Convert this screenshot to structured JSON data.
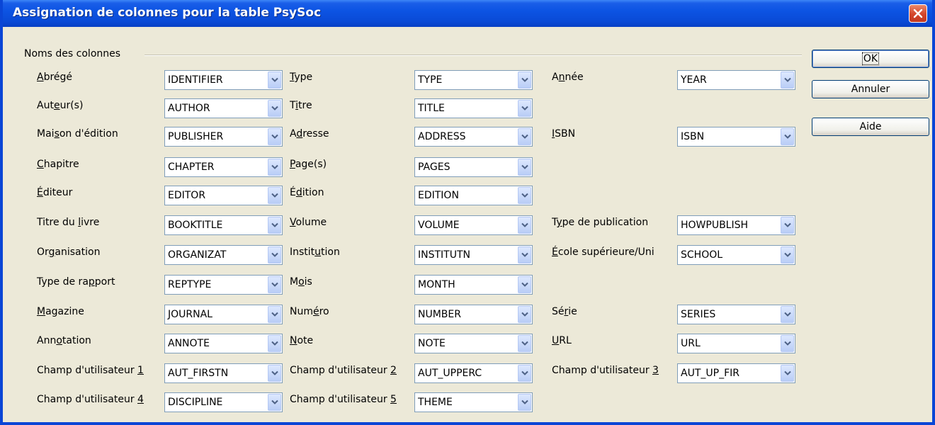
{
  "title": "Assignation de colonnes pour la table PsySoc",
  "group_label": "Noms des colonnes",
  "buttons": {
    "ok": "OK",
    "cancel": "Annuler",
    "help": "Aide"
  },
  "fields": [
    {
      "name": "abrege",
      "pre": "",
      "u": "A",
      "post": "brégé",
      "value": "IDENTIFIER"
    },
    {
      "name": "type",
      "pre": "",
      "u": "T",
      "post": "ype",
      "value": "TYPE"
    },
    {
      "name": "annee",
      "pre": "A",
      "u": "n",
      "post": "née",
      "value": "YEAR"
    },
    {
      "name": "auteurs",
      "pre": "Aut",
      "u": "e",
      "post": "ur(s)",
      "value": "AUTHOR"
    },
    {
      "name": "titre",
      "pre": "T",
      "u": "i",
      "post": "tre",
      "value": "TITLE"
    },
    {
      "name": "maison-edition",
      "pre": "Mai",
      "u": "s",
      "post": "on d'édition",
      "value": "PUBLISHER"
    },
    {
      "name": "adresse",
      "pre": "A",
      "u": "d",
      "post": "resse",
      "value": "ADDRESS"
    },
    {
      "name": "isbn",
      "pre": "",
      "u": "I",
      "post": "SBN",
      "value": "ISBN"
    },
    {
      "name": "chapitre",
      "pre": "",
      "u": "C",
      "post": "hapitre",
      "value": "CHAPTER"
    },
    {
      "name": "pages",
      "pre": "",
      "u": "P",
      "post": "age(s)",
      "value": "PAGES"
    },
    {
      "name": "editeur",
      "pre": "",
      "u": "É",
      "post": "diteur",
      "value": "EDITOR"
    },
    {
      "name": "edition",
      "pre": "É",
      "u": "d",
      "post": "ition",
      "value": "EDITION"
    },
    {
      "name": "titre-livre",
      "pre": "Titre du ",
      "u": "l",
      "post": "ivre",
      "value": "BOOKTITLE"
    },
    {
      "name": "volume",
      "pre": "",
      "u": "V",
      "post": "olume",
      "value": "VOLUME"
    },
    {
      "name": "type-publication",
      "pre": "T",
      "u": "y",
      "post": "pe de publication",
      "value": "HOWPUBLISH"
    },
    {
      "name": "organisation",
      "pre": "Or",
      "u": "g",
      "post": "anisation",
      "value": "ORGANIZAT"
    },
    {
      "name": "institution",
      "pre": "Instit",
      "u": "u",
      "post": "tion",
      "value": "INSTITUTN"
    },
    {
      "name": "ecole",
      "pre": "",
      "u": "É",
      "post": "cole supérieure/Uni",
      "value": "SCHOOL"
    },
    {
      "name": "type-rapport",
      "pre": "Type de ra",
      "u": "p",
      "post": "port",
      "value": "REPTYPE"
    },
    {
      "name": "mois",
      "pre": "M",
      "u": "o",
      "post": "is",
      "value": "MONTH"
    },
    {
      "name": "magazine",
      "pre": "",
      "u": "M",
      "post": "agazine",
      "value": "JOURNAL"
    },
    {
      "name": "numero",
      "pre": "Num",
      "u": "é",
      "post": "ro",
      "value": "NUMBER"
    },
    {
      "name": "serie",
      "pre": "Sé",
      "u": "r",
      "post": "ie",
      "value": "SERIES"
    },
    {
      "name": "annotation",
      "pre": "Ann",
      "u": "o",
      "post": "tation",
      "value": "ANNOTE"
    },
    {
      "name": "note",
      "pre": "",
      "u": "N",
      "post": "ote",
      "value": "NOTE"
    },
    {
      "name": "url",
      "pre": "",
      "u": "U",
      "post": "RL",
      "value": "URL"
    },
    {
      "name": "champ-1",
      "pre": "Champ d'utilisateur ",
      "u": "1",
      "post": "",
      "value": "AUT_FIRSTN"
    },
    {
      "name": "champ-2",
      "pre": "Champ d'utilisateur ",
      "u": "2",
      "post": "",
      "value": "AUT_UPPERC"
    },
    {
      "name": "champ-3",
      "pre": "Champ d'utilisateur ",
      "u": "3",
      "post": "",
      "value": "AUT_UP_FIR"
    },
    {
      "name": "champ-4",
      "pre": "Champ d'utilisateur ",
      "u": "4",
      "post": "",
      "value": "DISCIPLINE"
    },
    {
      "name": "champ-5",
      "pre": "Champ d'utilisateur ",
      "u": "5",
      "post": "",
      "value": "THEME"
    }
  ]
}
